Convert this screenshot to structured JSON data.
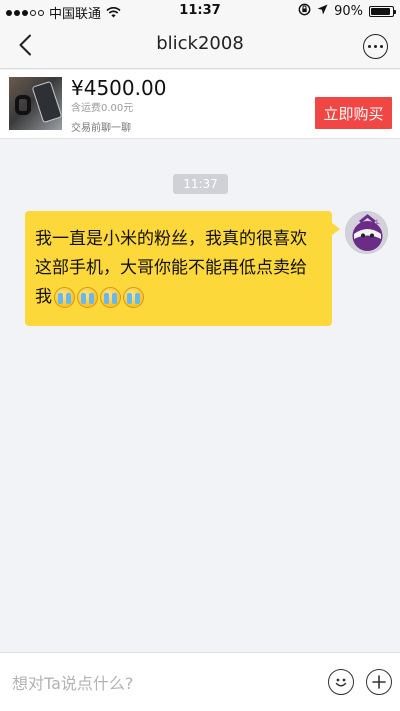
{
  "status_bar": {
    "carrier": "中国联通",
    "time": "11:37",
    "battery": "90%",
    "battery_level": 0.9,
    "icons": [
      "signal-icon",
      "wifi-icon",
      "lock-rotation-icon",
      "location-arrow-icon",
      "battery-icon"
    ]
  },
  "nav": {
    "title": "blick2008",
    "icons": [
      "back-chevron-icon",
      "more-icon"
    ]
  },
  "product": {
    "price": "¥4500.00",
    "shipping": "含运费0.00元",
    "trade_hint": "交易前聊一聊",
    "buy_label": "立即购买"
  },
  "chat": {
    "time_chip": "11:37",
    "messages": [
      {
        "text": "我一直是小米的粉丝，我真的很喜欢这部手机，大哥你能不能再低点卖给我",
        "emoji": "cry-emoji",
        "emoji_count": 4
      }
    ]
  },
  "input": {
    "placeholder": "想对Ta说点什么?",
    "value": "",
    "icons": [
      "emoji-icon",
      "plus-icon"
    ]
  },
  "colors": {
    "accent_red": "#f04644",
    "bubble_yellow": "#fdd83b",
    "background": "#f2f3f7"
  }
}
